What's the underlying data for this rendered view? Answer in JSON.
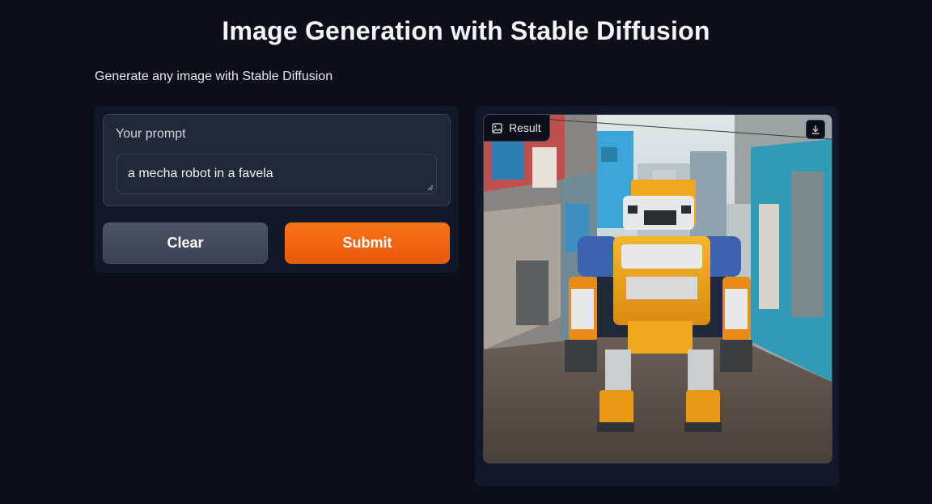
{
  "header": {
    "title": "Image Generation with Stable Diffusion",
    "description": "Generate any image with Stable Diffusion"
  },
  "input_panel": {
    "prompt_label": "Your prompt",
    "prompt_value": "a mecha robot in a favela",
    "resize_icon": "resize-handle-icon"
  },
  "actions": {
    "clear_label": "Clear",
    "submit_label": "Submit"
  },
  "output_panel": {
    "result_label": "Result",
    "image_icon": "image-icon",
    "download_icon": "download-icon"
  },
  "colors": {
    "background": "#0b0f19",
    "panel": "#111827",
    "accent": "#f97316",
    "secondary_button": "#4b5563"
  }
}
